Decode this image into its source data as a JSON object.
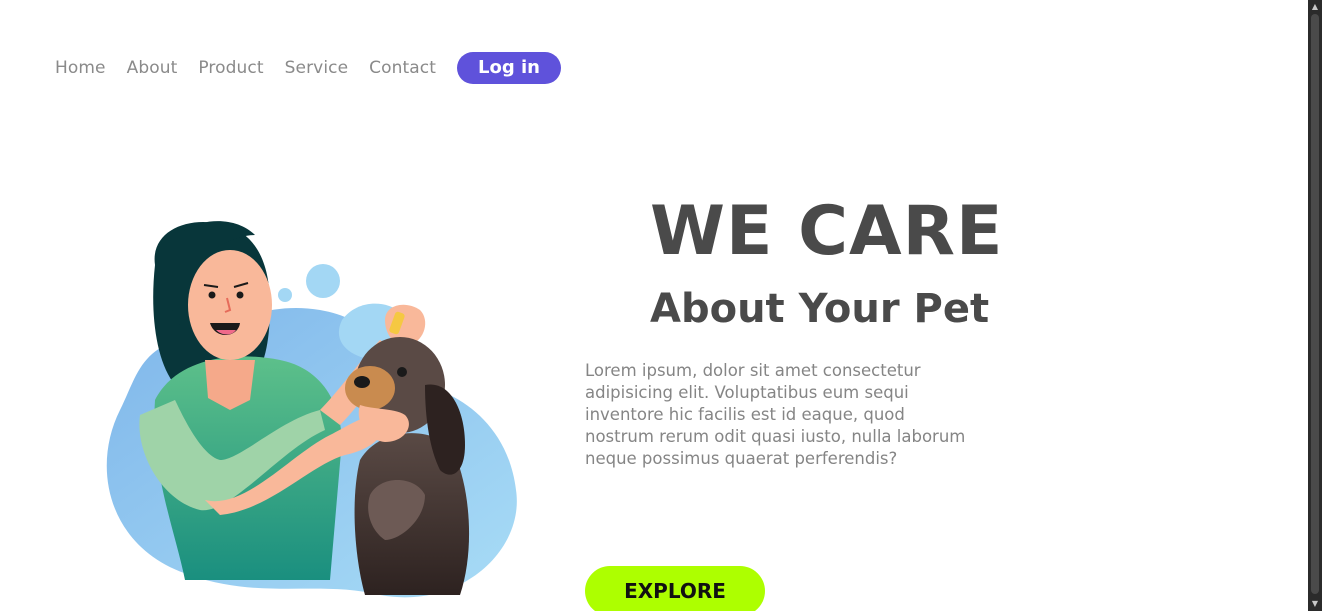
{
  "nav": {
    "links": [
      "Home",
      "About",
      "Product",
      "Service",
      "Contact"
    ],
    "login_label": "Log in"
  },
  "hero": {
    "title": "WE CARE",
    "subtitle": "About Your Pet",
    "paragraph": "Lorem ipsum, dolor sit amet consectetur adipisicing elit. Voluptatibus eum sequi inventore hic facilis est id eaque, quod nostrum rerum odit quasi iusto, nulla laborum neque possimus quaerat perferendis?",
    "cta_label": "EXPLORE"
  },
  "illustration": {
    "icon": "woman-grooming-dog-illustration"
  },
  "colors": {
    "accent_purple": "#5f52db",
    "accent_lime": "#adff00",
    "text_dark": "#4a4a4a",
    "text_muted": "#858585",
    "blob_blue": "#8ec9ef"
  },
  "scrollbar": {
    "up_icon": "chevron-up-icon",
    "down_icon": "chevron-down-icon"
  }
}
